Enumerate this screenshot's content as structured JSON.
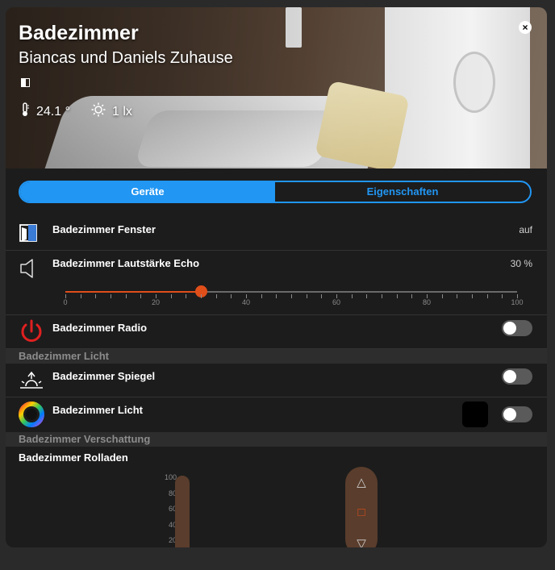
{
  "header": {
    "title": "Badezimmer",
    "subtitle": "Biancas und Daniels Zuhause",
    "temperature": "24.1 °",
    "illuminance": "1 lx",
    "close_symbol": "×"
  },
  "tabs": [
    {
      "label": "Geräte",
      "active": true
    },
    {
      "label": "Eigenschaften",
      "active": false
    }
  ],
  "devices": {
    "fenster": {
      "label": "Badezimmer Fenster",
      "value": "auf",
      "icon": "window-open-icon"
    },
    "echo": {
      "label": "Badezimmer Lautstärke Echo",
      "value": "30 %",
      "icon": "speaker-icon",
      "level_percent": 30,
      "scale": [
        "0",
        "20",
        "40",
        "60",
        "80",
        "100"
      ]
    },
    "radio": {
      "label": "Badezimmer Radio",
      "icon": "power-icon",
      "on": false
    }
  },
  "sections": {
    "licht": "Badezimmer Licht",
    "verschattung": "Badezimmer Verschattung"
  },
  "lights": {
    "spiegel": {
      "label": "Badezimmer Spiegel",
      "icon": "sun-rise-icon",
      "on": false
    },
    "licht": {
      "label": "Badezimmer Licht",
      "icon": "color-wheel-icon",
      "on": false,
      "color": "#000000"
    }
  },
  "rolladen": {
    "label": "Badezimmer Rolladen",
    "scale": [
      "100",
      "80",
      "60",
      "40",
      "20"
    ],
    "controls": [
      "△",
      "□",
      "▽"
    ]
  },
  "colors": {
    "accent": "#2196f3",
    "slider": "#e04e1a",
    "power": "#e02020",
    "blind": "#5a3d2c"
  }
}
